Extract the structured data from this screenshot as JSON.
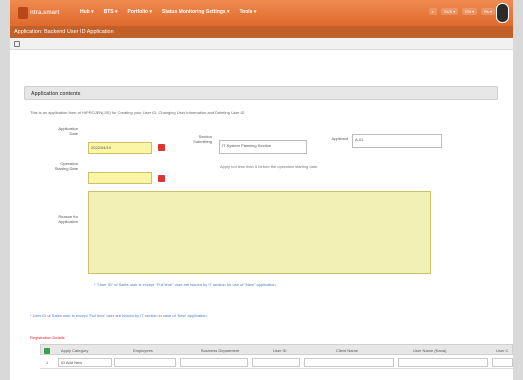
{
  "app": {
    "logo_text": "ntra.smart",
    "nav": [
      "Hub ▾",
      "BTS ▾",
      "Portfolio ▾",
      "Status Monitoring Settings ▾",
      "Tools ▾"
    ],
    "right_tools": [
      "⌕",
      "SUS ▾",
      "EN ▾",
      "Rs ▾"
    ]
  },
  "subheader": {
    "title": "Application: Backend User ID Application"
  },
  "section": {
    "title": "Application contents"
  },
  "intro": "This is an application form of HIPROJEN(JIS) for Creating your User ID, Changing User Information and Deleting User ID",
  "form": {
    "application_date_label": "Application Date",
    "application_date_value": "2022/04/19",
    "operation_start_label": "Operation Starting Date",
    "operation_start_value": "",
    "operation_hint": "Apply not less than 5 before the operation starting date.",
    "section_label": "Section Submitting",
    "section_value": "IT System Planning Section",
    "applicant_label": "Applicant",
    "applicant_value": "A-01",
    "reason_label": "Reason for Application",
    "reason_value": "",
    "note_inside": "* \"User ID\" of Sales user is except \"Full time\" user are issued by IT section for use of \"New\" application.",
    "note_outside": "* User ID of Sales user is except 'Full time' user are issued by IT section in case of 'New' application."
  },
  "table": {
    "title": "Registration Details",
    "headers": [
      "Apply Category",
      "Employees",
      "Business Department",
      "User ID",
      "Client Name",
      "User Name (Kana)",
      "User C"
    ],
    "rows": [
      {
        "num": "1",
        "category": "ID Add New"
      }
    ]
  }
}
